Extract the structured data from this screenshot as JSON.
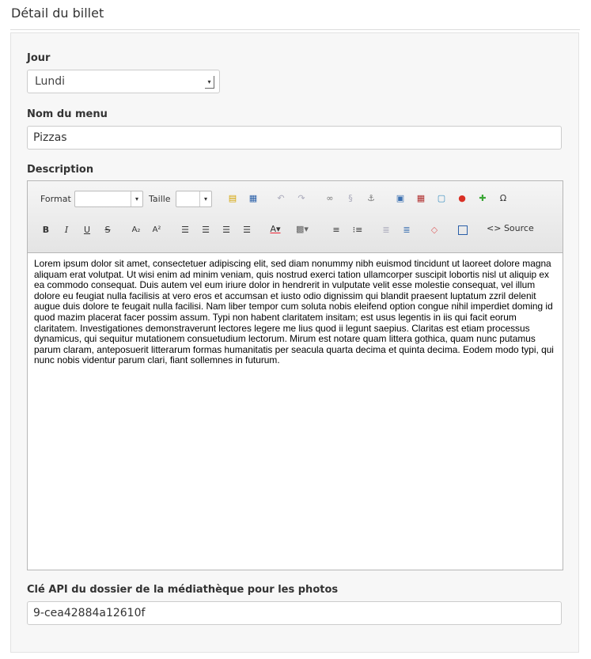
{
  "page": {
    "title": "Détail du billet"
  },
  "form": {
    "day_label": "Jour",
    "day_value": "Lundi",
    "menu_label": "Nom du menu",
    "menu_value": "Pizzas",
    "description_label": "Description",
    "api_label": "Clé API du dossier de la médiathèque pour les photos",
    "api_value": "9-cea42884a12610f"
  },
  "toolbar": {
    "format_label": "Format",
    "size_label": "Taille",
    "bold": "B",
    "italic": "I",
    "underline": "U",
    "strike": "S",
    "subscript": "A₂",
    "superscript": "A²",
    "omega": "Ω",
    "source_label": "Source"
  },
  "editor": {
    "content": "Lorem ipsum dolor sit amet, consectetuer adipiscing elit, sed diam nonummy nibh euismod tincidunt ut laoreet dolore magna aliquam erat volutpat. Ut wisi enim ad minim veniam, quis nostrud exerci tation ullamcorper suscipit lobortis nisl ut aliquip ex ea commodo consequat. Duis autem vel eum iriure dolor in hendrerit in vulputate velit esse molestie consequat, vel illum dolore eu feugiat nulla facilisis at vero eros et accumsan et iusto odio dignissim qui blandit praesent luptatum zzril delenit augue duis dolore te feugait nulla facilisi. Nam liber tempor cum soluta nobis eleifend option congue nihil imperdiet doming id quod mazim placerat facer possim assum. Typi non habent claritatem insitam; est usus legentis in iis qui facit eorum claritatem. Investigationes demonstraverunt lectores legere me lius quod ii legunt saepius. Claritas est etiam processus dynamicus, qui sequitur mutationem consuetudium lectorum. Mirum est notare quam littera gothica, quam nunc putamus parum claram, anteposuerit litterarum formas humanitatis per seacula quarta decima et quinta decima. Eodem modo typi, qui nunc nobis videntur parum clari, fiant sollemnes in futurum."
  }
}
